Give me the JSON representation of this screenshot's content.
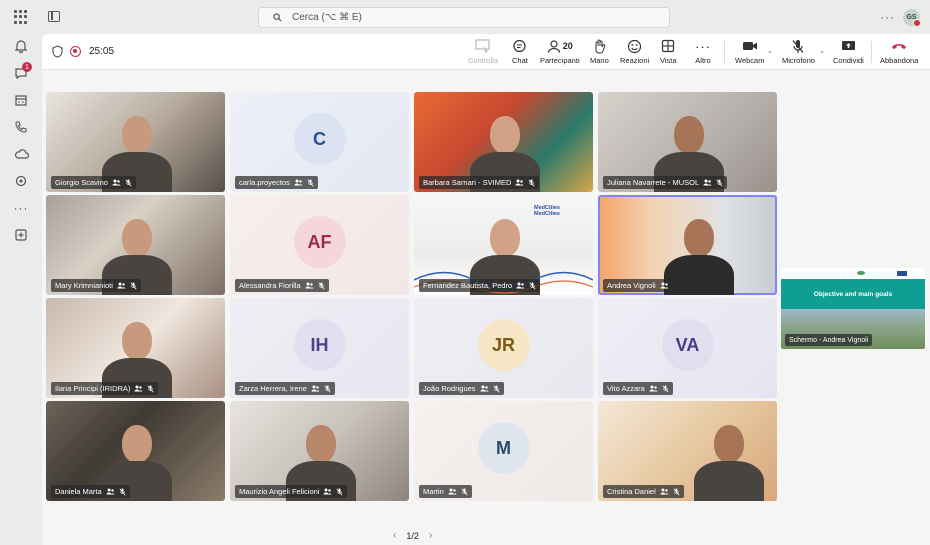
{
  "search": {
    "placeholder": "Cerca (⌥ ⌘ E)"
  },
  "user": {
    "initials": "GS"
  },
  "rail": {
    "chat_badge": "1"
  },
  "meeting": {
    "timer": "25:05"
  },
  "toolbar": {
    "controlla": "Controlla",
    "chat": "Chat",
    "participants_count": "20",
    "participants": "Partecipanti",
    "mano": "Mano",
    "reazioni": "Reazioni",
    "vista": "Vista",
    "altro": "Altro",
    "webcam": "Webcam",
    "microfono": "Microfono",
    "condividi": "Condividi",
    "abbandona": "Abbandona"
  },
  "participants": [
    {
      "name": "Giorgio Scavino",
      "initials": "",
      "video": true
    },
    {
      "name": "carla.proyectos",
      "initials": "C",
      "video": false
    },
    {
      "name": "Barbara Sarnari - SVIMED",
      "initials": "",
      "video": true
    },
    {
      "name": "Juliana Navarrete - MUSOL",
      "initials": "",
      "video": true
    },
    {
      "name": "Mary Krimnianioti",
      "initials": "",
      "video": true
    },
    {
      "name": "Alessandra Fiorilla",
      "initials": "AF",
      "video": false
    },
    {
      "name": "Fernandez Bautista, Pedro",
      "initials": "",
      "video": true
    },
    {
      "name": "Andrea Vignoli",
      "initials": "",
      "video": true
    },
    {
      "name": "Ilaria Principi (IRIDRA)",
      "initials": "",
      "video": true
    },
    {
      "name": "Zarza Herrera, Irene",
      "initials": "IH",
      "video": false
    },
    {
      "name": "João Rodrigues",
      "initials": "JR",
      "video": false
    },
    {
      "name": "Vito Azzara",
      "initials": "VA",
      "video": false
    },
    {
      "name": "Daniela Marta",
      "initials": "",
      "video": true
    },
    {
      "name": "Maurizio Angeli Felicioni",
      "initials": "",
      "video": true
    },
    {
      "name": "Martin",
      "initials": "M",
      "video": false
    },
    {
      "name": "Cristina Daniel",
      "initials": "",
      "video": true
    }
  ],
  "tile_logo": {
    "line1": "MedCities",
    "line2": "MedCities"
  },
  "pager": {
    "label": "1/2"
  },
  "share": {
    "slide_title": "Objective and main goals",
    "tag": "Schermo - Andrea Vignoli"
  }
}
